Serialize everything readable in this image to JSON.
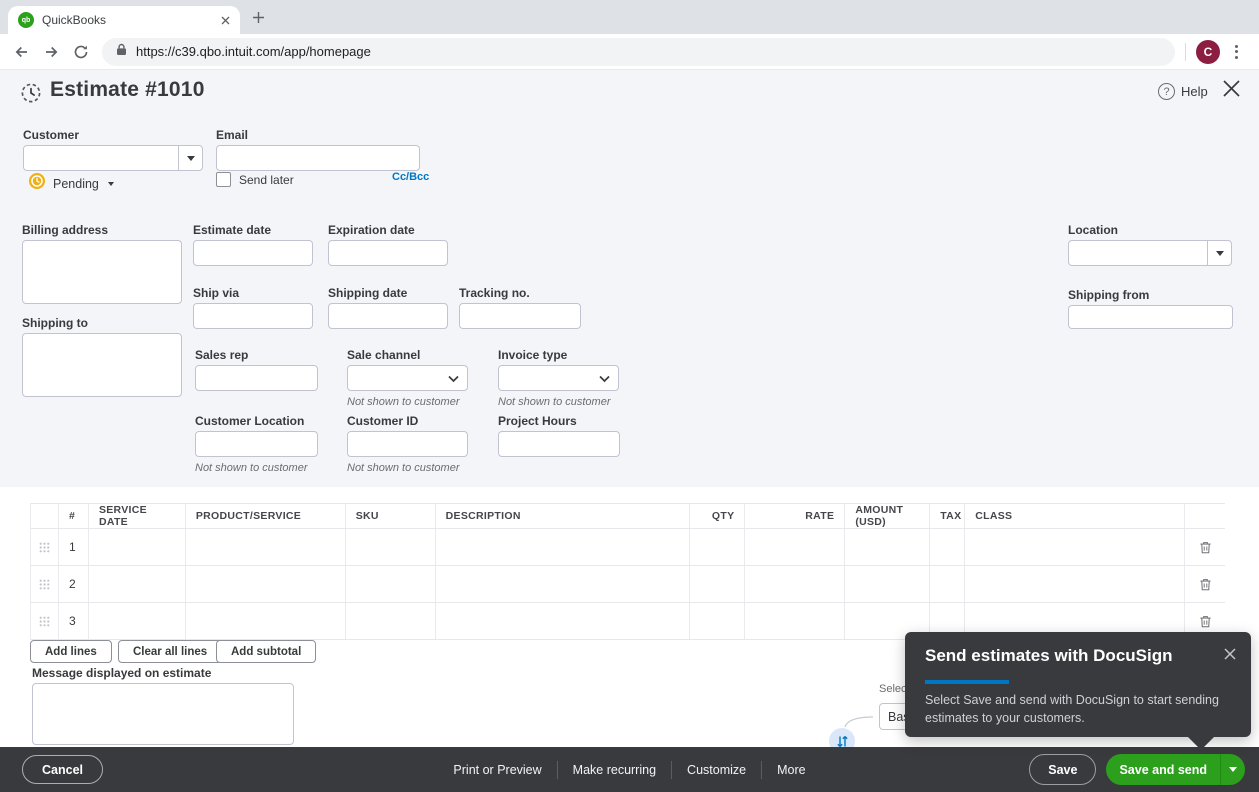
{
  "browser": {
    "tab_title": "QuickBooks",
    "url": "https://c39.qbo.intuit.com/app/homepage",
    "avatar_initial": "C",
    "qb_logo_text": "qb"
  },
  "header": {
    "title": "Estimate #1010",
    "help_label": "Help",
    "help_glyph": "?"
  },
  "form": {
    "customer_label": "Customer",
    "email_label": "Email",
    "status_label": "Pending",
    "send_later_label": "Send later",
    "ccbcc_label": "Cc/Bcc",
    "billing_address_label": "Billing address",
    "shipping_to_label": "Shipping to",
    "estimate_date_label": "Estimate date",
    "expiration_date_label": "Expiration date",
    "ship_via_label": "Ship via",
    "shipping_date_label": "Shipping date",
    "tracking_no_label": "Tracking no.",
    "location_label": "Location",
    "shipping_from_label": "Shipping from",
    "sales_rep_label": "Sales rep",
    "sale_channel_label": "Sale channel",
    "invoice_type_label": "Invoice type",
    "customer_location_label": "Customer Location",
    "customer_id_label": "Customer ID",
    "project_hours_label": "Project Hours",
    "not_shown_note": "Not shown to customer"
  },
  "table": {
    "headers": [
      "#",
      "SERVICE DATE",
      "PRODUCT/SERVICE",
      "SKU",
      "DESCRIPTION",
      "QTY",
      "RATE",
      "AMOUNT (USD)",
      "TAX",
      "CLASS"
    ],
    "rows": [
      {
        "num": "1"
      },
      {
        "num": "2"
      },
      {
        "num": "3"
      }
    ]
  },
  "line_actions": {
    "add_lines": "Add lines",
    "clear_all": "Clear all lines",
    "add_subtotal": "Add subtotal"
  },
  "message": {
    "label": "Message displayed on estimate"
  },
  "tax_fragment": {
    "select_label": "Select",
    "value": "Bas"
  },
  "popup": {
    "title": "Send estimates with DocuSign",
    "body": "Select Save and send with DocuSign to start sending estimates to your customers."
  },
  "footer": {
    "cancel": "Cancel",
    "actions": [
      "Print or Preview",
      "Make recurring",
      "Customize",
      "More"
    ],
    "save": "Save",
    "save_and_send": "Save and send"
  },
  "colors": {
    "qb_green": "#2ca01c",
    "accent_blue": "#0077c5",
    "pending_amber": "#efb014",
    "bar_dark": "#393a3d",
    "avatar_maroon": "#8b1e41"
  }
}
